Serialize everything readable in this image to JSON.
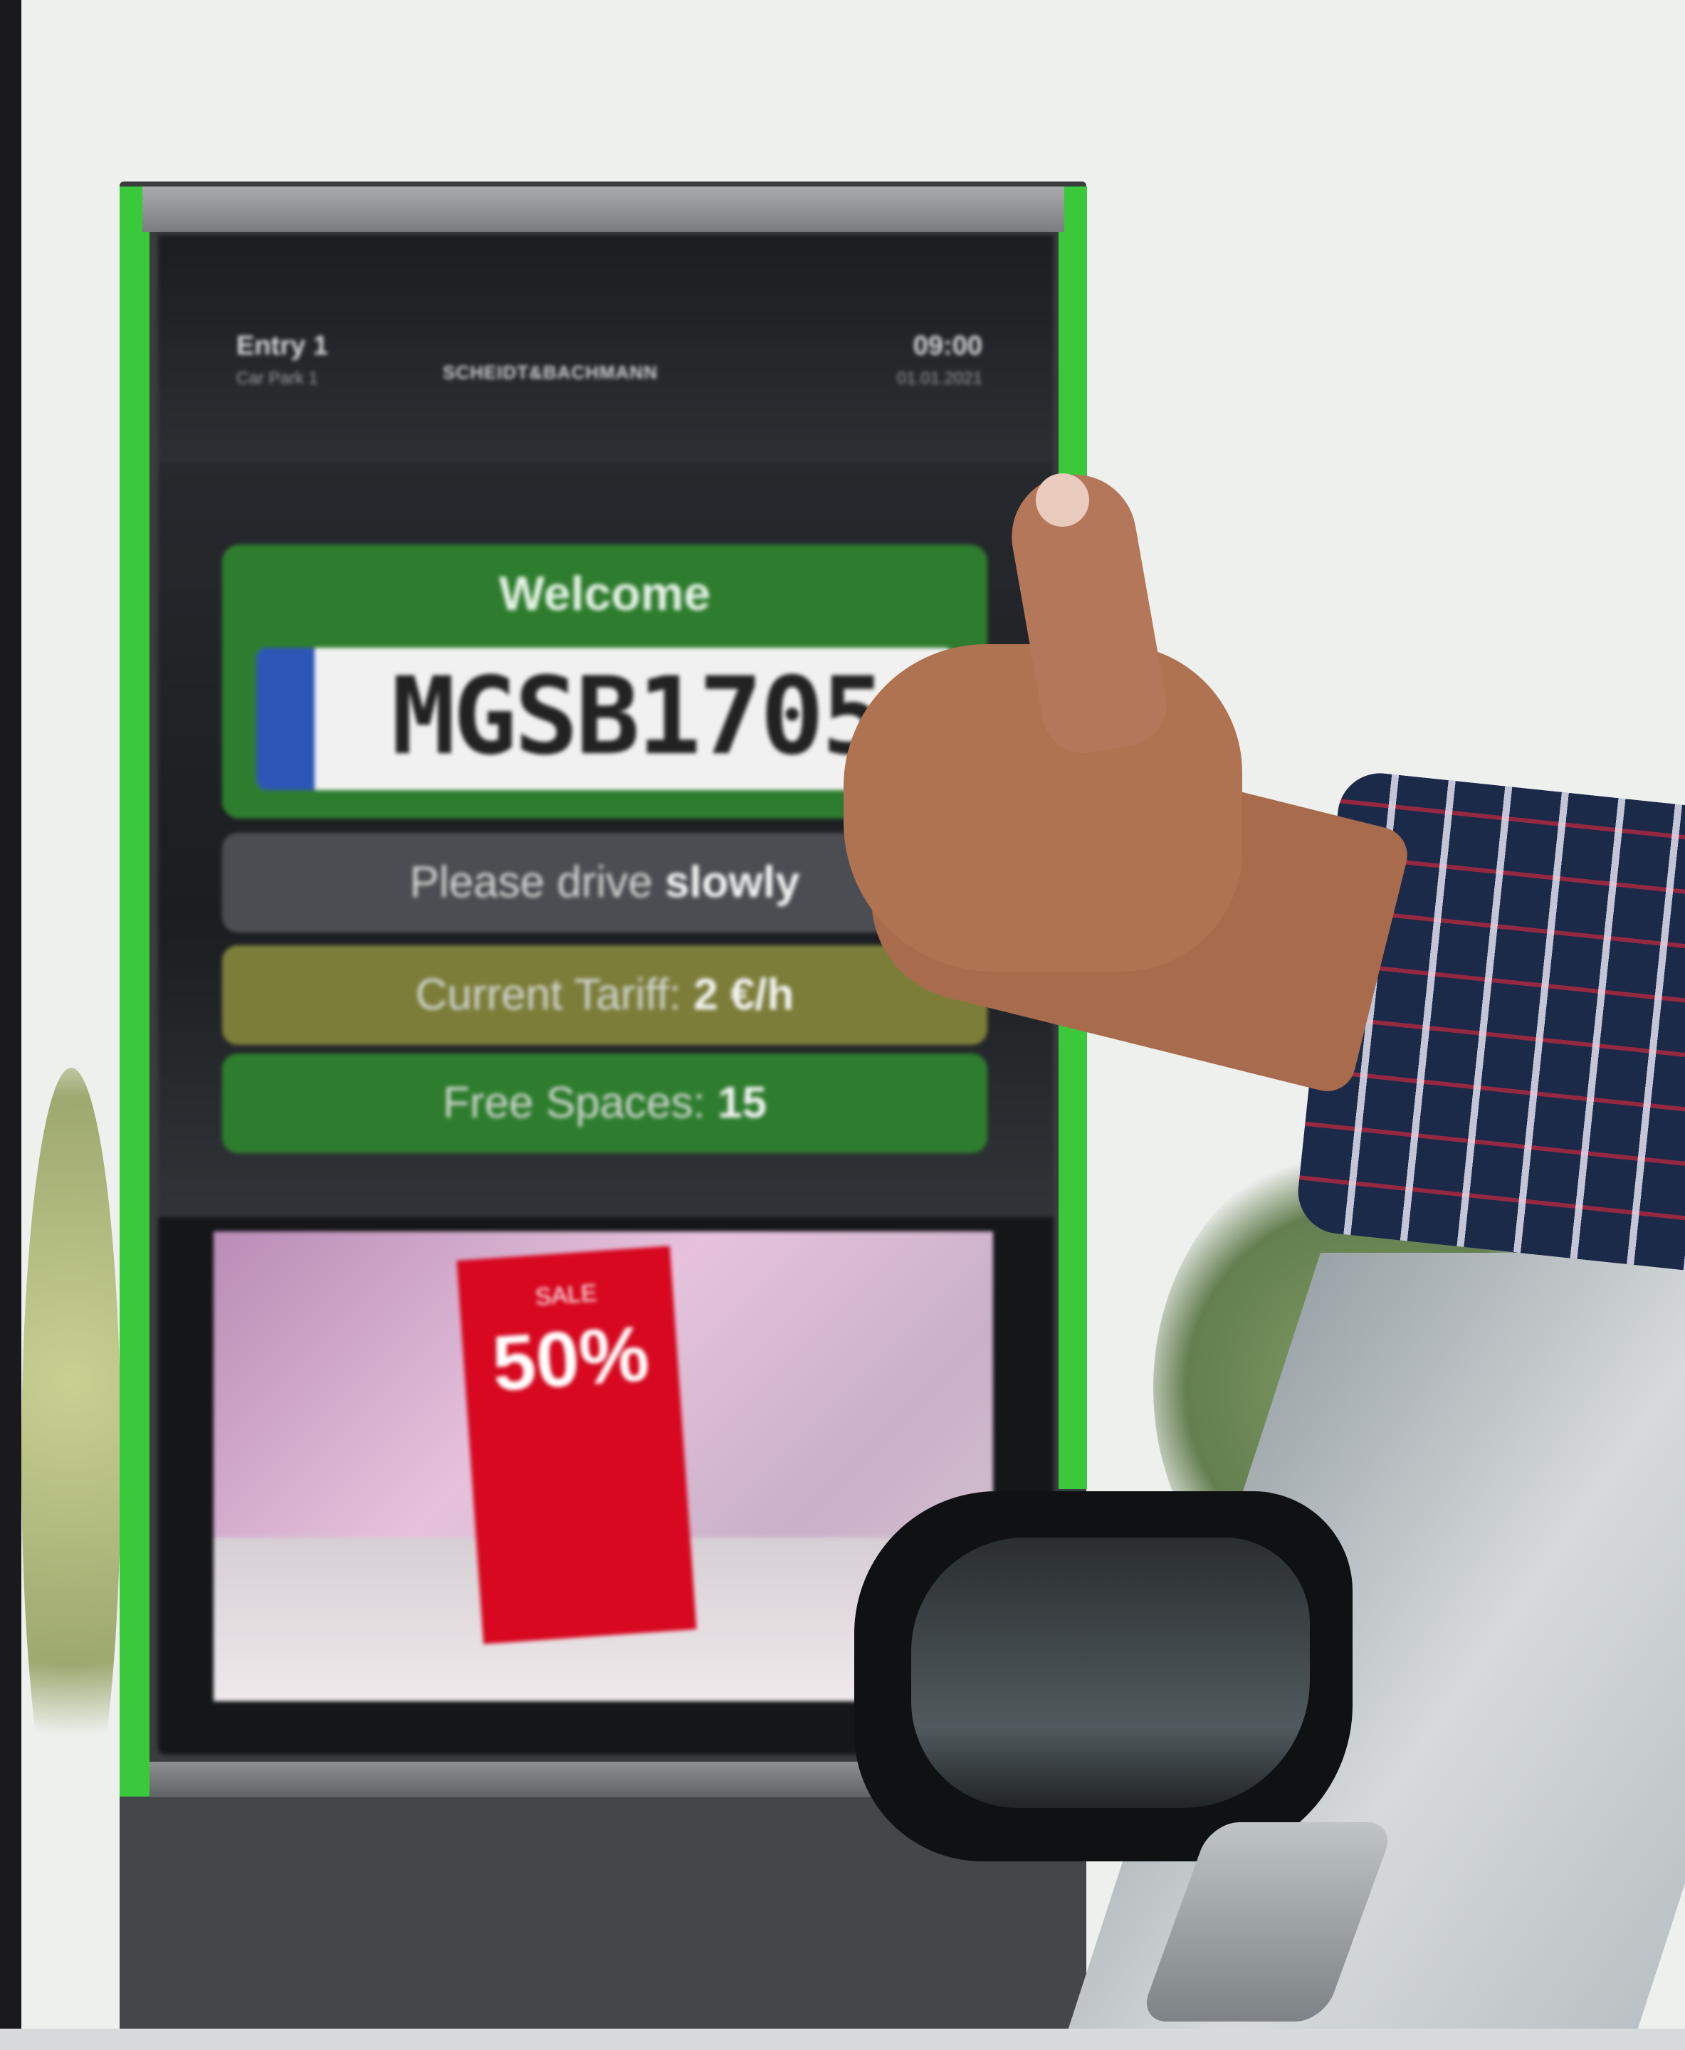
{
  "kiosk": {
    "header": {
      "left_line1": "Entry 1",
      "left_line2": "Car Park 1",
      "center": "SCHEIDT&BACHMANN",
      "right_line1": "09:00",
      "right_line2": "01.01.2021"
    },
    "welcome": "Welcome",
    "plate": "MGSB1705",
    "slow_prefix": "Please drive ",
    "slow_bold": "slowly",
    "tariff_prefix": "Current Tariff: ",
    "tariff_bold": "2 €/h",
    "spaces_prefix": "Free Spaces: ",
    "spaces_bold": "15",
    "ad": {
      "label": "SALE",
      "value": "50%"
    }
  },
  "colors": {
    "kiosk_green": "#39c93a",
    "panel_green": "#2e7d2e",
    "tariff_olive": "#7d7d3a",
    "plate_blue": "#2d57b6",
    "ad_red": "#d7081f"
  }
}
